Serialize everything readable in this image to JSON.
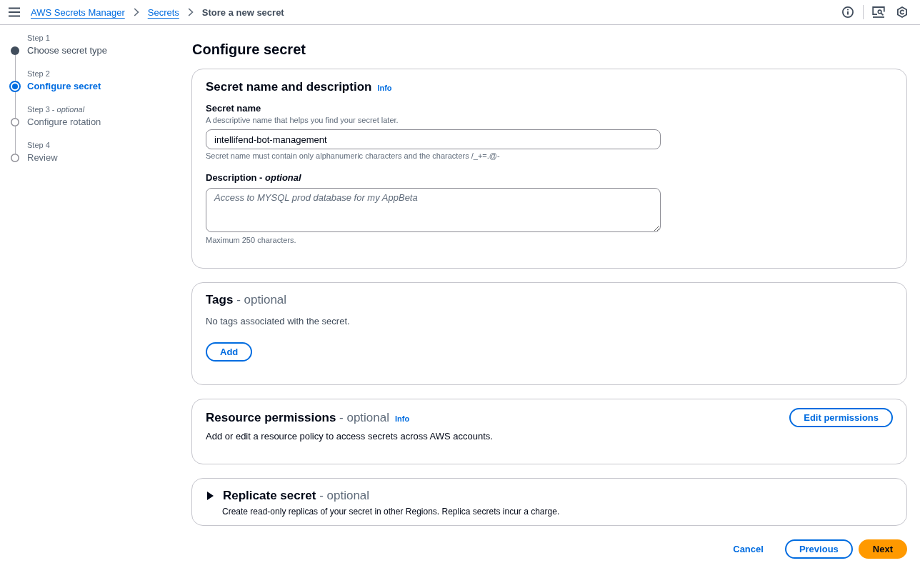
{
  "top_bar": {
    "breadcrumbs": [
      {
        "label": "AWS Secrets Manager",
        "kind": "link"
      },
      {
        "label": "Secrets",
        "kind": "link"
      },
      {
        "label": "Store a new secret",
        "kind": "current"
      }
    ]
  },
  "steps": [
    {
      "label": "Step 1",
      "title": "Choose secret type",
      "completed": true,
      "selected": false
    },
    {
      "label": "Step 2",
      "title": "Configure secret",
      "completed": false,
      "selected": true
    },
    {
      "label": "Step 3 - *optional*",
      "title": "Configure rotation",
      "completed": false,
      "selected": false
    },
    {
      "label": "Step 4",
      "title": "Review",
      "completed": false,
      "selected": false
    }
  ],
  "page_title": "Configure secret",
  "secret_details": {
    "title": "Secret name and description",
    "info": "Info",
    "name_field": {
      "label": "Secret name",
      "description": "A descriptive name that helps you find your secret later.",
      "value": "intellifend-bot-management",
      "constraint": "Secret name must contain only alphanumeric characters and the characters /_+=.@-"
    },
    "description_field": {
      "label": "Description - *optional*",
      "placeholder": "Access to MYSQL prod database for my AppBeta",
      "constraint": "Maximum 250 characters."
    }
  },
  "tags": {
    "title": "Tags",
    "qualifier": "- optional",
    "empty_text": "No tags associated with the secret.",
    "button": "Add"
  },
  "resource_permissions": {
    "title": "Resource permissions",
    "qualifier": "- optional",
    "info": "Info",
    "text": "Add or edit a resource policy to access secrets across AWS accounts.",
    "button": "Edit permissions"
  },
  "replication": {
    "title": "Replicate secret",
    "qualifier": "- optional",
    "text": "Create read-only replicas of your secret in other Regions. Replica secrets incur a charge.",
    "expanded": false
  },
  "footer_buttons": [
    {
      "label": "Cancel",
      "kind": "link"
    },
    {
      "label": "Previous",
      "kind": "normal"
    },
    {
      "label": "Next",
      "kind": "primary"
    }
  ]
}
